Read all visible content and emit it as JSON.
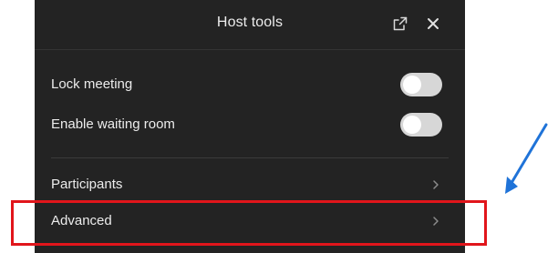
{
  "panel": {
    "title": "Host tools",
    "icons": {
      "popout": "popout-icon",
      "close": "close-icon"
    }
  },
  "settings": [
    {
      "label": "Lock meeting",
      "toggle": "off"
    },
    {
      "label": "Enable waiting room",
      "toggle": "off"
    }
  ],
  "navigation": [
    {
      "label": "Participants",
      "icon": "chevron-right-icon"
    },
    {
      "label": "Advanced",
      "icon": "chevron-right-icon"
    }
  ],
  "annotations": {
    "highlight_color": "#e1151b",
    "arrow_color": "#1f73d8"
  }
}
